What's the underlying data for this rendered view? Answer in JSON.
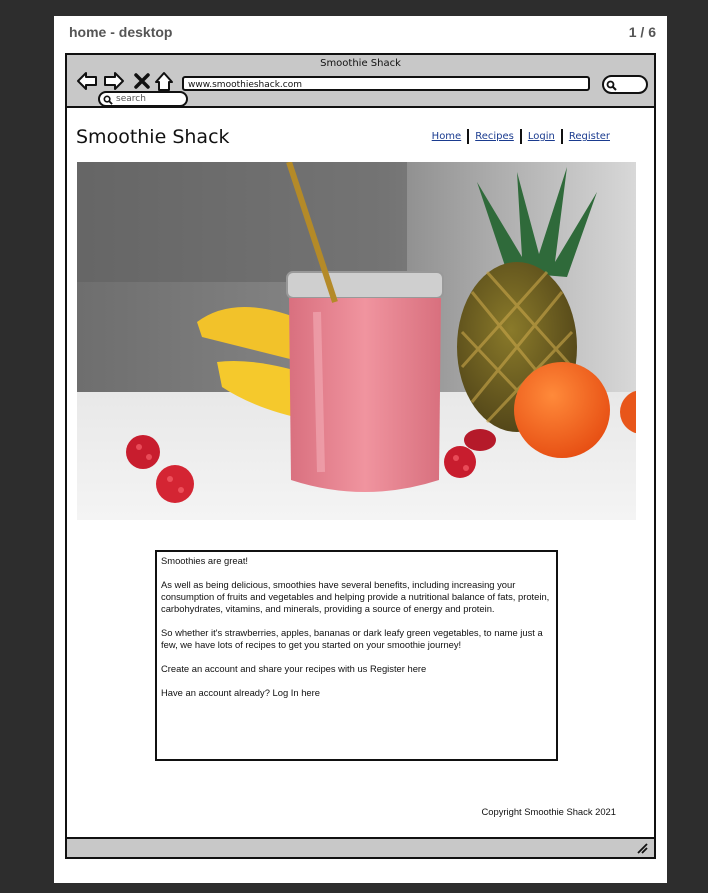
{
  "sheet": {
    "title": "home - desktop",
    "pages": "1 / 6"
  },
  "browser": {
    "window_title": "Smoothie Shack",
    "url": "www.smoothieshack.com",
    "search_placeholder": "search",
    "icons": [
      "back-arrow-icon",
      "forward-arrow-icon",
      "close-x-icon",
      "home-icon",
      "search-icon",
      "resize-grip-icon"
    ]
  },
  "site": {
    "title": "Smoothie Shack",
    "nav": [
      "Home",
      "Recipes",
      "Login",
      "Register"
    ]
  },
  "content": {
    "heading": "Smoothies are great!",
    "p1": "As well as being delicious, smoothies have several benefits, including increasing your consumption of fruits and vegetables and helping provide a nutritional balance of fats, protein, carbohydrates, vitamins, and minerals, providing a source of energy and protein.",
    "p2": "So whether it's strawberries, apples, bananas or dark leafy green vegetables, to name just a few, we have lots of recipes to get you started on your smoothie journey!",
    "p3": "Create an account and share your recipes with us Register here",
    "p4": "Have an account already? Log In here"
  },
  "footer": {
    "copyright": "Copyright Smoothie Shack 2021"
  },
  "colors": {
    "page_bg": "#2d2d2d",
    "chrome": "#c8c8c8",
    "link": "#1a3b8f",
    "smoothie": "#e98596"
  }
}
